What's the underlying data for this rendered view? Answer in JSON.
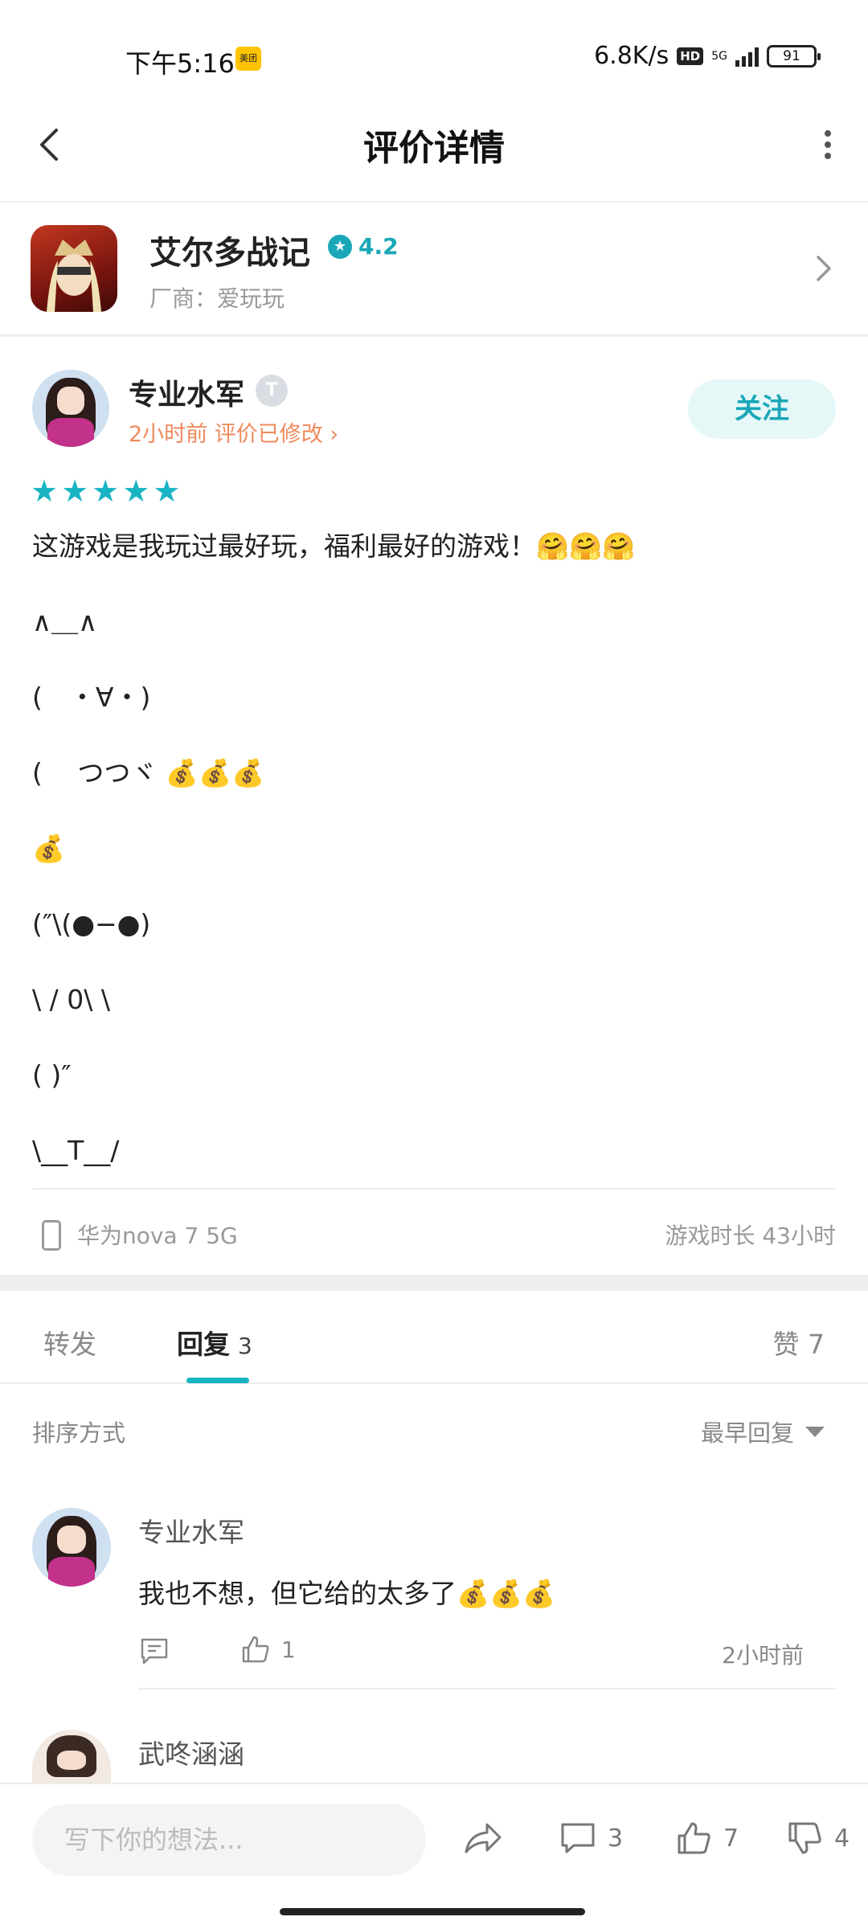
{
  "status_bar": {
    "time": "下午5:16",
    "app_badge": "美团",
    "net_speed": "6.8K/s",
    "hd": "HD",
    "network": "5G",
    "battery": "91"
  },
  "header": {
    "title": "评价详情"
  },
  "game": {
    "name": "艾尔多战记",
    "rating": "4.2",
    "developer": "厂商：爱玩玩"
  },
  "review": {
    "author": "专业水军",
    "level": "T",
    "meta": "2小时前 评价已修改 ›",
    "follow_label": "关注",
    "stars": 5,
    "lines": [
      "这游戏是我玩过最好玩，福利最好的游戏！🤗🤗🤗",
      "∧＿∧",
      "(　・∀・)",
      "(　 つつヾ 💰💰💰",
      "💰",
      "(″\\(●−●)",
      "\\ / 0\\ \\",
      "( )″",
      "\\__T__/"
    ],
    "device": "华为nova 7 5G",
    "play_time": "游戏时长 43小时"
  },
  "tabs": {
    "repost": "转发",
    "reply": "回复",
    "reply_count": "3",
    "likes": "赞 7"
  },
  "sort": {
    "label": "排序方式",
    "selected": "最早回复"
  },
  "replies": [
    {
      "author": "专业水军",
      "text": "我也不想，但它给的太多了💰💰💰",
      "likes": "1",
      "time": "2小时前"
    },
    {
      "author": "武咚涵涵"
    }
  ],
  "bottom_bar": {
    "input_placeholder": "写下你的想法...",
    "comment_count": "3",
    "like_count": "7",
    "dislike_count": "4"
  },
  "colors": {
    "accent": "#19b4c4",
    "meta_orange": "#f08a5d"
  }
}
